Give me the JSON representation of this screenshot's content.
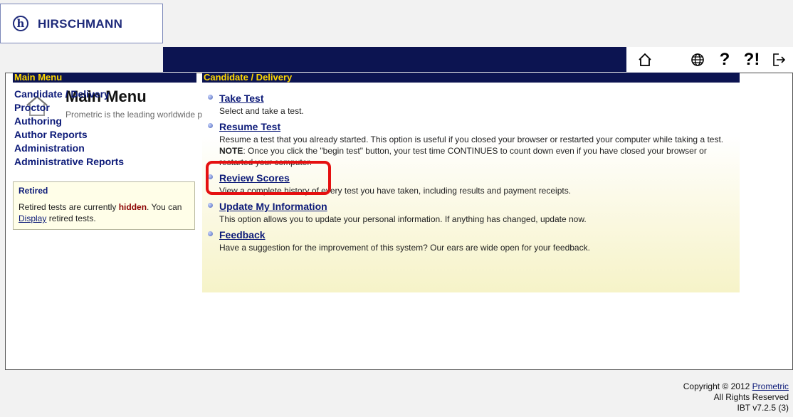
{
  "brand": {
    "logo_letter": "h",
    "name": "HIRSCHMANN"
  },
  "top_icons": [
    "home-icon",
    "globe-icon",
    "help-icon",
    "context-help-icon",
    "logout-icon"
  ],
  "top_help_text": "?",
  "top_context_help_text": "?!",
  "header": {
    "title": "Main Menu",
    "subtitle": "Prometric is the leading worldwide provider of comprehensive technology-based testing and assessment services."
  },
  "sidebar": {
    "heading": "Main Menu",
    "items": [
      {
        "label": "Candidate / Delivery"
      },
      {
        "label": "Proctor"
      },
      {
        "label": "Authoring"
      },
      {
        "label": "Author Reports"
      },
      {
        "label": "Administration"
      },
      {
        "label": "Administrative Reports"
      }
    ],
    "retired": {
      "title": "Retired",
      "text_before": "Retired tests are currently ",
      "hidden_word": "hidden",
      "text_middle": ". You can ",
      "link": "Display",
      "text_after": " retired tests."
    }
  },
  "content": {
    "heading": "Candidate / Delivery",
    "items": [
      {
        "title": "Take Test",
        "desc": "Select and take a test."
      },
      {
        "title": "Resume Test",
        "desc": "Resume a test that you already started. This option is useful if you closed your browser or restarted your computer while taking a test.",
        "note_label": "NOTE",
        "note": ": Once you click the \"begin test\" button, your test time CONTINUES to count down even if you have closed your browser or restarted your computer."
      },
      {
        "title": "Review Scores",
        "desc": "View a complete history of every test you have taken, including results and payment receipts."
      },
      {
        "title": "Update My Information",
        "desc": "This option allows you to update your personal information. If anything has changed, update now."
      },
      {
        "title": "Feedback",
        "desc": "Have a suggestion for the improvement of this system? Our ears are wide open for your feedback."
      }
    ]
  },
  "footer": {
    "copyright_prefix": "Copyright © 2012 ",
    "company_link": "Prometric",
    "rights": "All Rights Reserved",
    "version": "IBT v7.2.5 (3)"
  },
  "colors": {
    "nav_bg": "#0c1451",
    "heading_text": "#ffd800",
    "link": "#0c1a78",
    "highlight": "#e51010"
  }
}
